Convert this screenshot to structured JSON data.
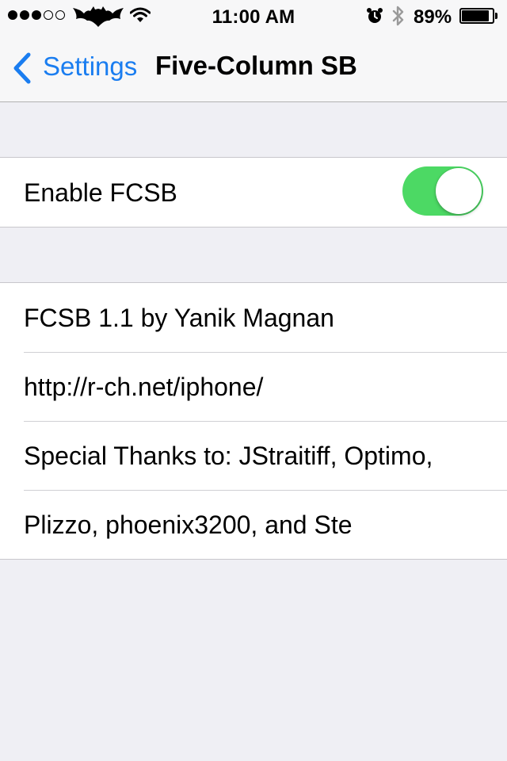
{
  "status_bar": {
    "time": "11:00 AM",
    "battery_percent_label": "89%",
    "battery_level": 0.89,
    "signal_bars_filled": 3,
    "signal_bars_total": 5,
    "carrier_icon": "bat-logo-icon",
    "wifi_icon": "wifi-icon",
    "alarm_icon": "alarm-clock-icon",
    "bluetooth_icon": "bluetooth-icon"
  },
  "nav": {
    "back_label": "Settings",
    "title": "Five-Column SB",
    "accent_color": "#1a7df0"
  },
  "settings": {
    "enable_label": "Enable FCSB",
    "enable_on": true,
    "toggle_on_color": "#4cd964"
  },
  "info": {
    "rows": [
      "FCSB 1.1 by Yanik Magnan",
      "http://r-ch.net/iphone/",
      "Special Thanks to: JStraitiff, Optimo,",
      "Plizzo, phoenix3200, and Ste"
    ]
  },
  "background_color": "#efeff4"
}
